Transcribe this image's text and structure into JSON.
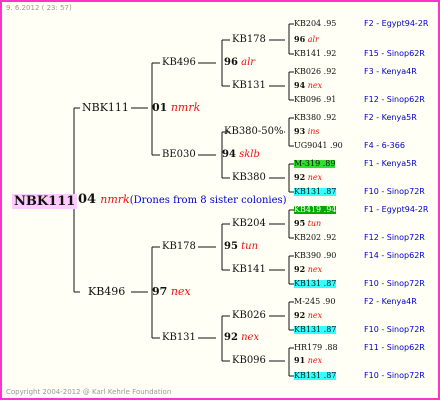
{
  "header": {
    "date": "9. 6.2012 ( 23: 57)"
  },
  "footer": {
    "copyright": "Copyright 2004-2012 @ Karl Kehrle Foundation"
  },
  "pedigree": {
    "root": {
      "id": "NBK111",
      "year": "04",
      "color": "nmrk",
      "note": "(Drones from 8 sister colonies)"
    },
    "gen1": [
      {
        "id": "NBK111",
        "year": "01",
        "color": "nmrk"
      },
      {
        "id": "KB496",
        "year": "97",
        "color": "nex"
      }
    ],
    "gen2": [
      {
        "id": "KB496"
      },
      {
        "id": "BE030",
        "year": "94",
        "color": "sklb"
      },
      {
        "id": "KB178"
      },
      {
        "id": "KB131"
      }
    ],
    "gen3": [
      {
        "id": "KB178",
        "year": "96",
        "color": "alr"
      },
      {
        "id": "KB131",
        "year": "94",
        "color": "nex"
      },
      {
        "id": "KB380-50%",
        "year": "93",
        "color": "ins"
      },
      {
        "id": "KB380",
        "year": "92",
        "color": "nex"
      },
      {
        "id": "KB204",
        "year": "95",
        "color": "tun"
      },
      {
        "id": "KB141",
        "year": "92",
        "color": "nex"
      },
      {
        "id": "KB026",
        "year": "92",
        "color": "nex"
      },
      {
        "id": "KB096",
        "year": "91",
        "color": "nex"
      }
    ],
    "gen4": [
      {
        "id": "KB204 .95",
        "bb": "F2 - Egypt94-2R"
      },
      {
        "id": "KB141 .92",
        "bb": "F15 - Sinop62R"
      },
      {
        "id": "KB026 .92",
        "bb": "F3 - Kenya4R"
      },
      {
        "id": "KB096 .91",
        "bb": "F12 - Sinop62R"
      },
      {
        "id": "KB380 .92",
        "bb": "F2 - Kenya5R"
      },
      {
        "id": "UG9041 .90",
        "bb": "F4 - 6-366"
      },
      {
        "id": "M-319 .89",
        "bb": "F1 - Kenya5R"
      },
      {
        "id": "KB131 .87",
        "bb": "F10 - Sinop72R"
      },
      {
        "id": "KB419 .94",
        "bb": "F1 - Egypt94-2R"
      },
      {
        "id": "KB202 .92",
        "bb": "F12 - Sinop72R"
      },
      {
        "id": "KB390 .90",
        "bb": "F14 - Sinop62R"
      },
      {
        "id": "KB131 .87",
        "bb": "F10 - Sinop72R"
      },
      {
        "id": "M-245 .90",
        "bb": "F2 - Kenya4R"
      },
      {
        "id": "KB131 .87",
        "bb": "F10 - Sinop72R"
      },
      {
        "id": "HR179 .88",
        "bb": "F11 - Sinop62R"
      },
      {
        "id": "KB131 .87",
        "bb": "F10 - Sinop72R"
      }
    ]
  }
}
